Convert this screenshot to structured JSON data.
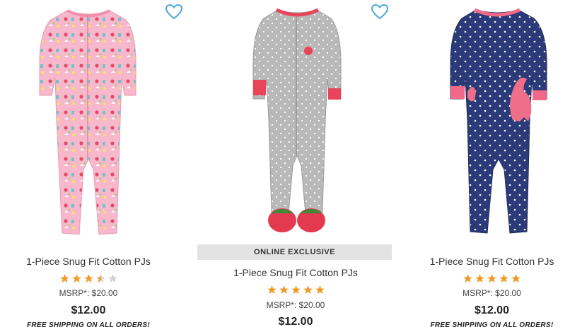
{
  "colors": {
    "heart": "#4aa6d8",
    "star_filled": "#f29a25",
    "star_empty": "#d0d0d0",
    "badge_bg": "#e3e3e3"
  },
  "products": [
    {
      "title": "1-Piece Snug Fit Cotton PJs",
      "rating": 3.5,
      "rating_max": 5,
      "msrp": "MSRP*: $20.00",
      "price": "$12.00",
      "shipping": "FREE SHIPPING ON ALL ORDERS!",
      "image_icon": "pink-unicorn-footed-pajamas"
    },
    {
      "badge": "ONLINE EXCLUSIVE",
      "title": "1-Piece Snug Fit Cotton PJs",
      "rating": 5,
      "rating_max": 5,
      "msrp": "MSRP*: $20.00",
      "price": "$12.00",
      "image_icon": "gray-strawberry-footed-pajamas",
      "wishlist_icon": "heart-outline-icon"
    },
    {
      "title": "1-Piece Snug Fit Cotton PJs",
      "rating": 5,
      "rating_max": 5,
      "msrp": "MSRP*: $20.00",
      "price": "$12.00",
      "shipping": "FREE SHIPPING ON ALL ORDERS!",
      "image_icon": "navy-dinosaur-footed-pajamas",
      "wishlist_icon": "heart-outline-icon"
    }
  ]
}
